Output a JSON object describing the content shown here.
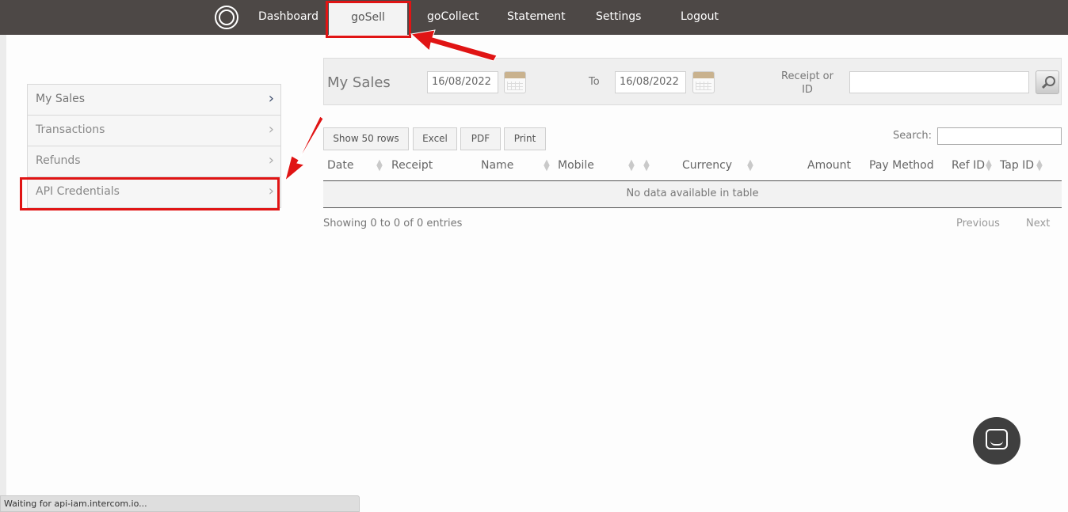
{
  "nav": {
    "items": [
      "Dashboard",
      "goSell",
      "goCollect",
      "Statement",
      "Settings",
      "Logout"
    ],
    "active": "goSell"
  },
  "sidebar": {
    "items": [
      {
        "label": "My Sales"
      },
      {
        "label": "Transactions"
      },
      {
        "label": "Refunds"
      },
      {
        "label": "API Credentials"
      }
    ]
  },
  "filter": {
    "title": "My Sales",
    "from_date": "16/08/2022",
    "to_label": "To",
    "to_date": "16/08/2022",
    "receipt_label": "Receipt or ID",
    "receipt_value": ""
  },
  "toolbar": {
    "show_rows": "Show 50 rows",
    "excel": "Excel",
    "pdf": "PDF",
    "print": "Print",
    "search_label": "Search:",
    "search_value": ""
  },
  "table": {
    "columns": [
      "Date",
      "Receipt",
      "Name",
      "Mobile",
      "Currency",
      "Amount",
      "Pay Method",
      "Ref ID",
      "Tap ID"
    ],
    "empty_message": "No data available in table",
    "info": "Showing 0 to 0 of 0 entries",
    "previous": "Previous",
    "next": "Next"
  },
  "status_bar": "Waiting for api-iam.intercom.io...",
  "colors": {
    "topbar": "#4d4846",
    "highlight": "#e01414",
    "chat": "#3f3f3f"
  }
}
